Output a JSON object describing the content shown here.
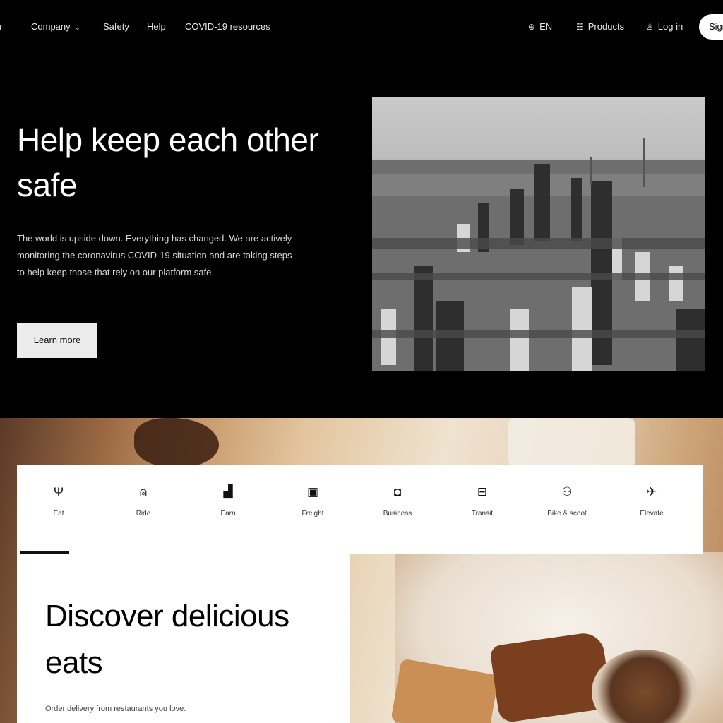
{
  "nav": {
    "brand_partial": "er",
    "company": "Company",
    "safety": "Safety",
    "help": "Help",
    "covid": "COVID-19 resources",
    "lang": "EN",
    "products": "Products",
    "login": "Log in",
    "signup": "Sign up"
  },
  "hero": {
    "title": "Help keep each other safe",
    "body": "The world is upside down. Everything has changed. We are actively monitoring the coronavirus COVID-19 situation and are taking steps to help keep those that rely on our platform safe.",
    "cta": "Learn more"
  },
  "tabs": [
    {
      "label": "Eat",
      "icon": "fork-knife-icon",
      "active": true
    },
    {
      "label": "Ride",
      "icon": "car-icon",
      "active": false
    },
    {
      "label": "Earn",
      "icon": "bar-chart-icon",
      "active": false
    },
    {
      "label": "Freight",
      "icon": "truck-icon",
      "active": false
    },
    {
      "label": "Business",
      "icon": "briefcase-icon",
      "active": false
    },
    {
      "label": "Transit",
      "icon": "train-icon",
      "active": false
    },
    {
      "label": "Bike & scoot",
      "icon": "bike-icon",
      "active": false
    },
    {
      "label": "Elevate",
      "icon": "elevate-icon",
      "active": false
    }
  ],
  "card": {
    "title": "Discover delicious eats",
    "subtitle": "Order delivery from restaurants you love."
  },
  "colors": {
    "background": "#000000",
    "surface": "#ffffff",
    "button": "#ececec"
  }
}
